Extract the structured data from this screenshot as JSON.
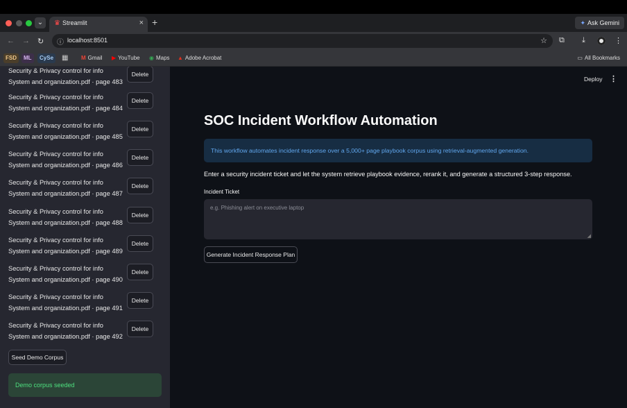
{
  "browser": {
    "tab_title": "Streamlit",
    "new_tab": "+",
    "gemini": "Ask Gemini",
    "url": "localhost:8501",
    "bookmarks": {
      "fsd": "FSD",
      "ml": "ML",
      "cyse": "CySe",
      "gmail": "Gmail",
      "youtube": "YouTube",
      "maps": "Maps",
      "acrobat": "Adobe Acrobat",
      "all": "All Bookmarks"
    }
  },
  "sidebar": {
    "docs": [
      {
        "line1": "Security & Privacy control for info",
        "line2": "System and organization.pdf · page 483"
      },
      {
        "line1": "Security & Privacy control for info",
        "line2": "System and organization.pdf · page 484"
      },
      {
        "line1": "Security & Privacy control for info",
        "line2": "System and organization.pdf · page 485"
      },
      {
        "line1": "Security & Privacy control for info",
        "line2": "System and organization.pdf · page 486"
      },
      {
        "line1": "Security & Privacy control for info",
        "line2": "System and organization.pdf · page 487"
      },
      {
        "line1": "Security & Privacy control for info",
        "line2": "System and organization.pdf · page 488"
      },
      {
        "line1": "Security & Privacy control for info",
        "line2": "System and organization.pdf · page 489"
      },
      {
        "line1": "Security & Privacy control for info",
        "line2": "System and organization.pdf · page 490"
      },
      {
        "line1": "Security & Privacy control for info",
        "line2": "System and organization.pdf · page 491"
      },
      {
        "line1": "Security & Privacy control for info",
        "line2": "System and organization.pdf · page 492"
      }
    ],
    "delete_label": "Delete",
    "seed_label": "Seed Demo Corpus",
    "success_msg": "Demo corpus seeded"
  },
  "header": {
    "deploy": "Deploy"
  },
  "main": {
    "title": "SOC Incident Workflow Automation",
    "info": "This workflow automates incident response over a 5,000+ page playbook corpus using retrieval-augmented generation.",
    "description": "Enter a security incident ticket and let the system retrieve playbook evidence, rerank it, and generate a structured 3-step response.",
    "ticket_label": "Incident Ticket",
    "ticket_placeholder": "e.g. Phishing alert on executive laptop",
    "generate_label": "Generate Incident Response Plan"
  }
}
